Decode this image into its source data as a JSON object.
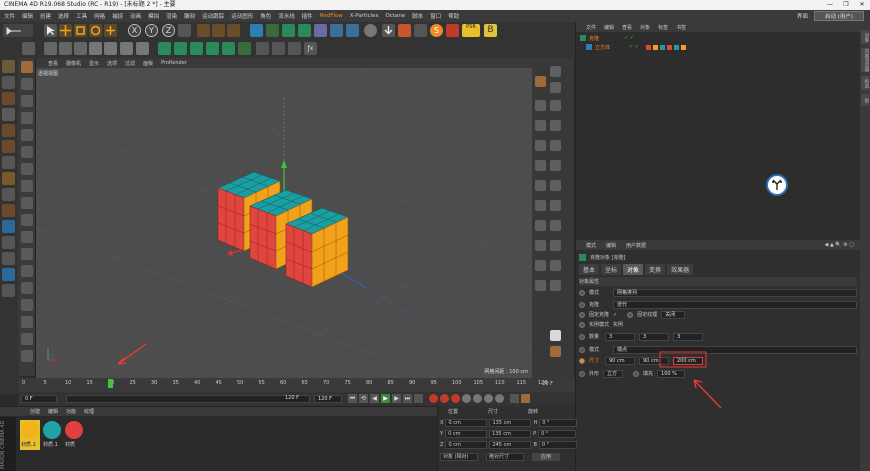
{
  "window": {
    "title": "CINEMA 4D R19.068 Studio (RC - R19) - [未标题 2 *] - 主要",
    "controls": [
      "—",
      "❐",
      "✕"
    ]
  },
  "menubar": {
    "items": [
      "文件",
      "编辑",
      "创建",
      "选择",
      "工具",
      "网格",
      "捕捉",
      "动画",
      "模拟",
      "渲染",
      "雕刻",
      "运动跟踪",
      "运动图形",
      "角色",
      "流水线",
      "插件",
      "RedFlow",
      "X-Particles",
      "Octane",
      "脚本",
      "窗口",
      "帮助"
    ],
    "highlight": "RedFlow",
    "interface_label": "界面",
    "layout_value": "启动 (用户)"
  },
  "toolbar": {
    "axis_x": "X",
    "axis_y": "Y",
    "axis_z": "Z",
    "psr": "PSR"
  },
  "viewport": {
    "menu": [
      "查看",
      "摄像机",
      "显示",
      "选项",
      "过滤",
      "面板",
      "ProRender"
    ],
    "label": "透视视图",
    "grid_spacing": "网格间距 : 100 cm"
  },
  "object_manager": {
    "menu": [
      "文件",
      "编辑",
      "查看",
      "对象",
      "标签",
      "书签"
    ],
    "objects": [
      {
        "name": "克隆",
        "icons": "✓ ✓"
      },
      {
        "name": "立方体",
        "icons": "✓ ✓"
      }
    ]
  },
  "sidebar": {
    "tabs": [
      "对象",
      "内容浏览器",
      "构造",
      "层"
    ]
  },
  "attributes": {
    "menu": [
      "模式",
      "编辑",
      "用户数据"
    ],
    "object_title": "克隆对象 [克隆]",
    "tabs": [
      "基本",
      "坐标",
      "对象",
      "变换",
      "效果器"
    ],
    "active_tab": "对象",
    "section": "对象属性",
    "mode_label": "模式",
    "mode_value": "网格排列",
    "clone_label": "克隆",
    "clone_value": "迭代",
    "fix_clone_label": "固定克隆",
    "fix_texture_label": "固定纹理",
    "fix_texture_value": "关闭",
    "instance_mode_label": "实例模式",
    "instance_mode_value": "实例",
    "count_label": "数量",
    "count_values": [
      "3",
      "3",
      "3"
    ],
    "pattern_label": "模式",
    "pattern_value": "端点",
    "size_label": "尺寸",
    "size_values": [
      "90 cm",
      "90 cm",
      "200 cm"
    ],
    "shape_label": "外形",
    "shape_value": "立方",
    "fill_label": "填充",
    "fill_value": "100 %"
  },
  "timeline": {
    "ticks": [
      "0",
      "5",
      "10",
      "15",
      "20",
      "25",
      "30",
      "35",
      "40",
      "45",
      "50",
      "55",
      "60",
      "65",
      "70",
      "75",
      "80",
      "85",
      "90",
      "95",
      "100",
      "105",
      "110",
      "115",
      "120"
    ],
    "end_label": "20 F",
    "current_frame_value": 20,
    "start_field": "0 F",
    "end_field_a": "120 F",
    "end_field_b": "120 F",
    "min_field": "0 F"
  },
  "materials": {
    "menu": [
      "创建",
      "编辑",
      "功能",
      "纹理"
    ],
    "items": [
      {
        "name": "材质.2",
        "color": "#f2b31b"
      },
      {
        "name": "材质.1",
        "color": "#1fa3a8"
      },
      {
        "name": "材质",
        "color": "#e04040"
      }
    ],
    "brand": "MAXON CINEMA 4D"
  },
  "coordinates": {
    "headers": [
      "位置",
      "尺寸",
      "旋转"
    ],
    "rows": [
      {
        "axis": "X",
        "pos": "0 cm",
        "size": "135 cm",
        "rot_label": "H",
        "rot": "0 °"
      },
      {
        "axis": "Y",
        "pos": "0 cm",
        "size": "135 cm",
        "rot_label": "P",
        "rot": "0 °"
      },
      {
        "axis": "Z",
        "pos": "0 cm",
        "size": "245 cm",
        "rot_label": "B",
        "rot": "0 °"
      }
    ],
    "mode_a": "对象 (相对)",
    "mode_b": "绝对尺寸",
    "apply": "应用"
  },
  "colors": {
    "accent": "#f08a24",
    "cube_orange": "#f2a11a",
    "cube_teal": "#1b9ea1",
    "cube_red": "#e0463e",
    "annotation_red": "#e23b3b"
  }
}
